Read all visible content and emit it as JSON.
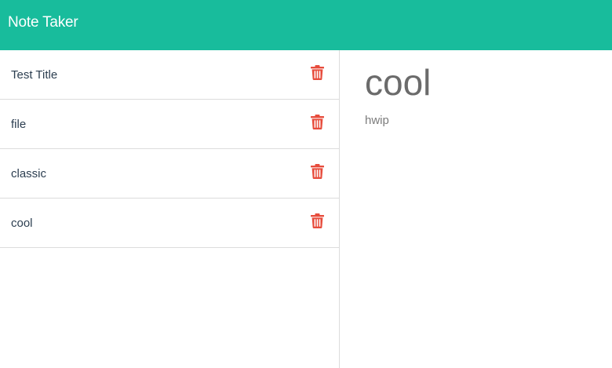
{
  "app": {
    "brand": "Note Taker"
  },
  "colors": {
    "navbar": "#18bc9c",
    "delete_icon": "#e74c3c"
  },
  "notes": [
    {
      "title": "Test Title",
      "delete_icon": "trash-icon"
    },
    {
      "title": "file",
      "delete_icon": "trash-icon"
    },
    {
      "title": "classic",
      "delete_icon": "trash-icon"
    },
    {
      "title": "cool",
      "delete_icon": "trash-icon"
    }
  ],
  "active_note": {
    "title": "cool",
    "text": "hwip"
  }
}
